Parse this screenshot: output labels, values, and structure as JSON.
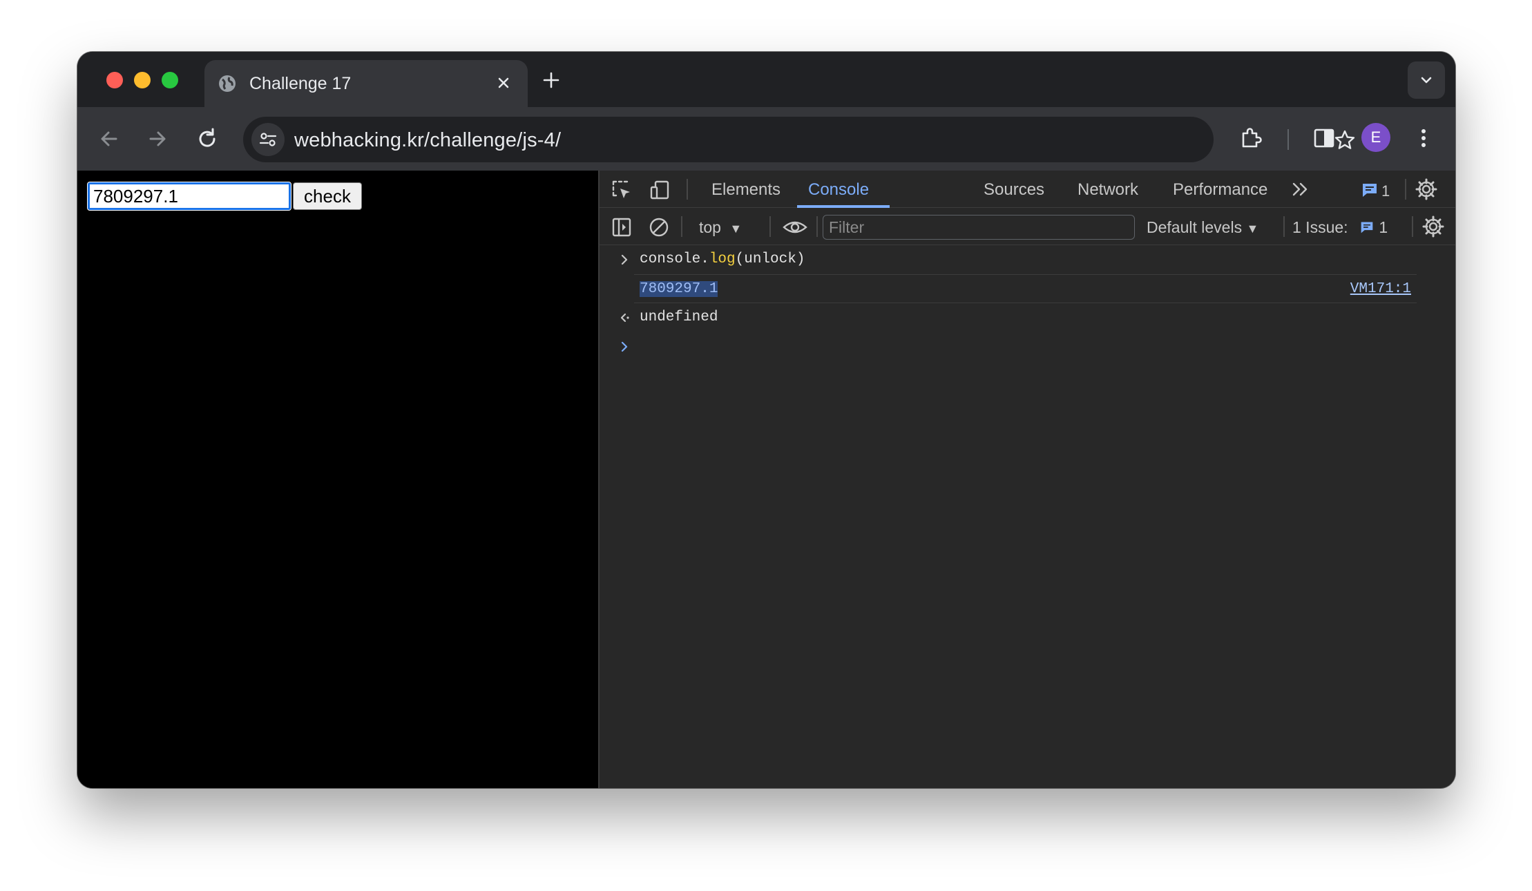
{
  "browser": {
    "tab_title": "Challenge 17",
    "url": "webhacking.kr/challenge/js-4/",
    "profile_initial": "E"
  },
  "page": {
    "input_value": "7809297.1",
    "check_label": "check"
  },
  "devtools": {
    "tabs": [
      "Elements",
      "Console",
      "Sources",
      "Network",
      "Performance"
    ],
    "active_tab": "Console",
    "message_count": "1",
    "context": "top",
    "filter_placeholder": "Filter",
    "levels": "Default levels",
    "issues_label": "1 Issue:",
    "issues_count": "1",
    "console": {
      "input_prefix": "console.",
      "input_fn": "log",
      "input_suffix": "(unlock)",
      "output_value": "7809297.1",
      "output_source": "VM171:1",
      "return_value": "undefined"
    }
  },
  "colors": {
    "accent": "#7cacf8",
    "avatar": "#7b4fc9"
  }
}
